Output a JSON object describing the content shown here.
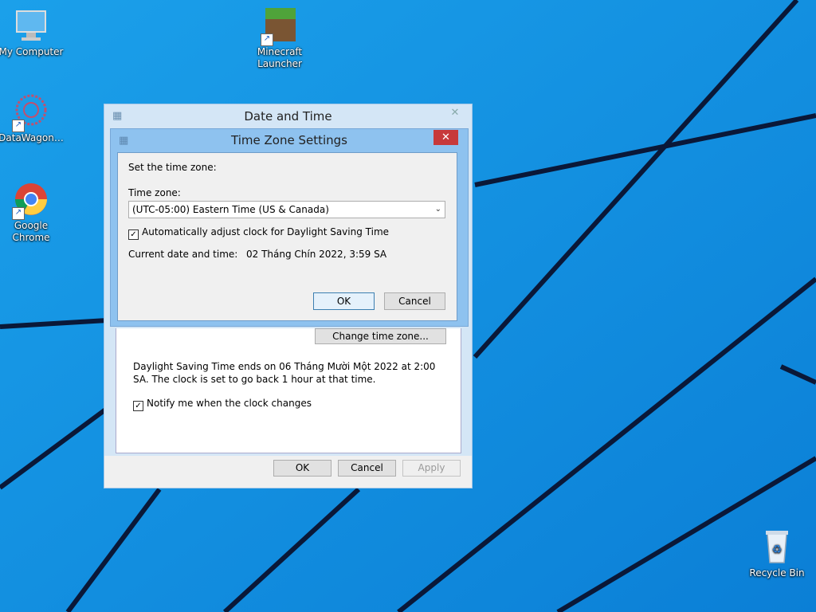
{
  "desktop": {
    "icons": [
      {
        "label": "My Computer",
        "icon": "computer-icon"
      },
      {
        "label": "Minecraft Launcher",
        "icon": "minecraft-icon"
      },
      {
        "label": "DataWagon…",
        "icon": "datawagon-icon"
      },
      {
        "label": "Google Chrome",
        "icon": "chrome-icon"
      },
      {
        "label": "Recycle Bin",
        "icon": "recycle-bin-icon"
      }
    ]
  },
  "date_time_window": {
    "title": "Date and Time",
    "change_tz_button": "Change time zone...",
    "dst_text": "Daylight Saving Time ends on 06 Tháng Mười Một 2022 at 2:00 SA. The clock is set to go back 1 hour at that time.",
    "notify_label": "Notify me when the clock changes",
    "notify_checked": true,
    "ok_button": "OK",
    "cancel_button": "Cancel",
    "apply_button": "Apply"
  },
  "time_zone_window": {
    "title": "Time Zone Settings",
    "set_label": "Set the time zone:",
    "tz_label": "Time zone:",
    "tz_value": "(UTC-05:00) Eastern Time (US & Canada)",
    "auto_dst_label": "Automatically adjust clock for Daylight Saving Time",
    "auto_dst_checked": true,
    "current_label": "Current date and time:",
    "current_value": "02 Tháng Chín 2022, 3:59 SA",
    "ok_button": "OK",
    "cancel_button": "Cancel"
  },
  "colors": {
    "desktop": "#1ea0e8",
    "close_button": "#c7393a"
  }
}
